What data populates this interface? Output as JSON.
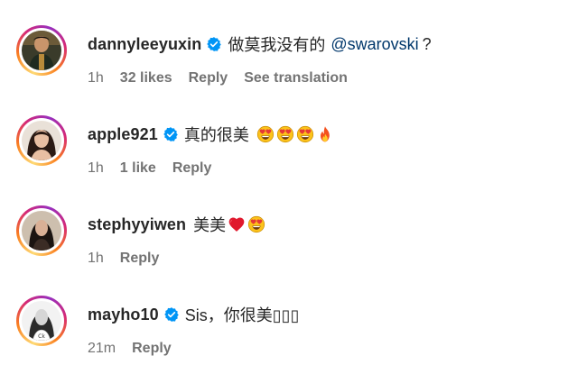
{
  "comments": [
    {
      "username": "dannyleeyuxin",
      "verified": true,
      "text": "做莫我没有的",
      "mention": "@swarovski",
      "text_suffix": "?",
      "time": "1h",
      "likes": "32 likes",
      "reply": "Reply",
      "see_translation": "See translation"
    },
    {
      "username": "apple921",
      "verified": true,
      "text": "真的很美",
      "emoji": [
        "heart-eyes",
        "heart-eyes",
        "heart-eyes",
        "fire"
      ],
      "time": "1h",
      "likes": "1 like",
      "reply": "Reply"
    },
    {
      "username": "stephyyiwen",
      "verified": false,
      "text": "美美",
      "emoji": [
        "red-heart",
        "heart-eyes"
      ],
      "time": "1h",
      "reply": "Reply"
    },
    {
      "username": "mayho10",
      "verified": true,
      "text": "Sis，你很美▯▯▯",
      "time": "21m",
      "reply": "Reply"
    }
  ],
  "colors": {
    "verified_badge": "#0095f6",
    "mention": "#00376b",
    "meta_text": "#737373",
    "primary_text": "#262626"
  }
}
